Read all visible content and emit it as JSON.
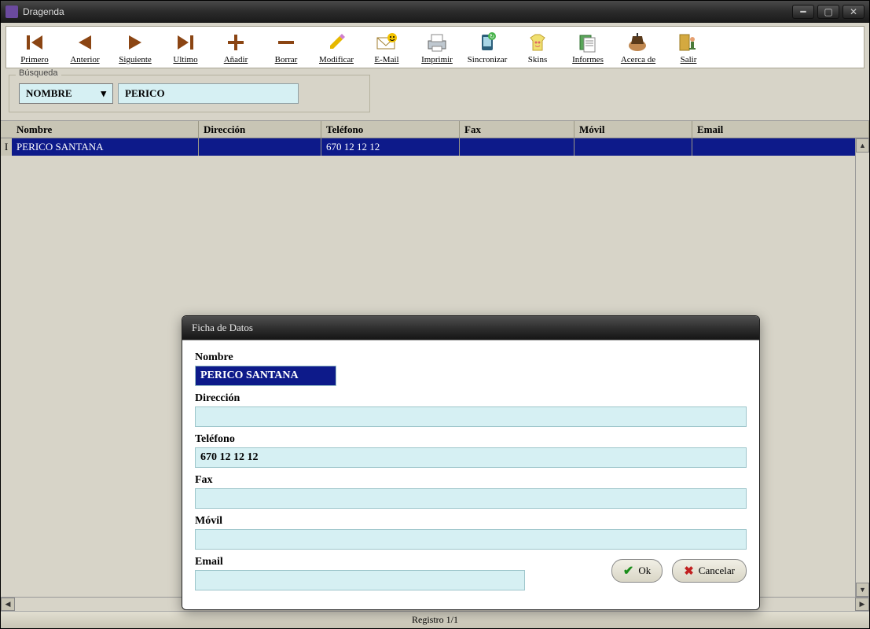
{
  "app": {
    "title": "Dragenda"
  },
  "toolbar": {
    "primero": "Primero",
    "anterior": "Anterior",
    "siguiente": "Siguiente",
    "ultimo": "Ultimo",
    "anadir": "Añadir",
    "borrar": "Borrar",
    "modificar": "Modificar",
    "email": "E-Mail",
    "imprimir": "Imprimir",
    "sincronizar": "Sincronizar",
    "skins": "Skins",
    "informes": "Informes",
    "acerca": "Acerca de",
    "salir": "Salir"
  },
  "search": {
    "legend": "Búsqueda",
    "field_label": "NOMBRE",
    "value": "PERICO"
  },
  "table": {
    "headers": {
      "nombre": "Nombre",
      "direccion": "Dirección",
      "telefono": "Teléfono",
      "fax": "Fax",
      "movil": "Móvil",
      "email": "Email"
    },
    "rows": [
      {
        "nombre": "PERICO SANTANA",
        "direccion": "",
        "telefono": "670 12 12 12",
        "fax": "",
        "movil": "",
        "email": ""
      }
    ]
  },
  "modal": {
    "title": "Ficha de Datos",
    "labels": {
      "nombre": "Nombre",
      "direccion": "Dirección",
      "telefono": "Teléfono",
      "fax": "Fax",
      "movil": "Móvil",
      "email": "Email"
    },
    "values": {
      "nombre": "PERICO SANTANA",
      "direccion": "",
      "telefono": "670 12 12 12",
      "fax": "",
      "movil": "",
      "email": ""
    },
    "ok": "Ok",
    "cancel": "Cancelar"
  },
  "status": "Registro 1/1"
}
